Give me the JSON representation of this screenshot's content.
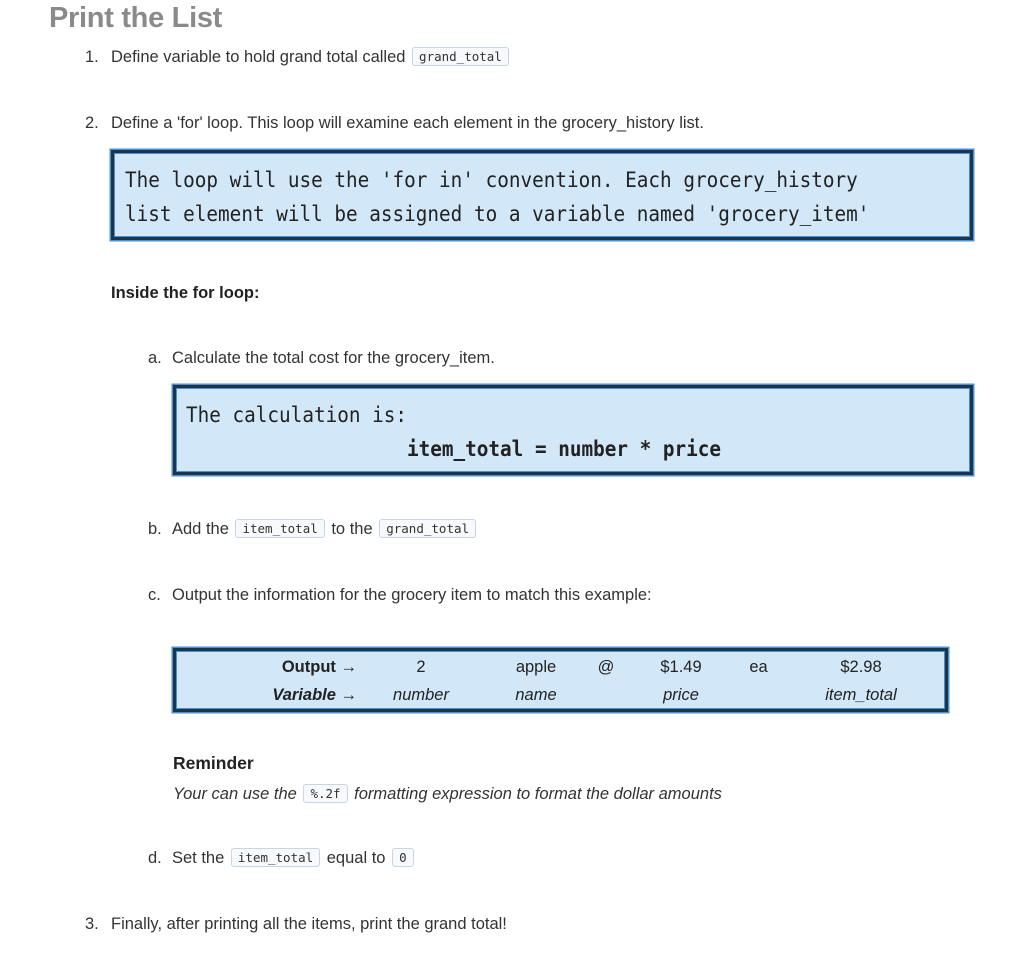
{
  "heading": "Print the List",
  "steps": {
    "s1": {
      "num": "1.",
      "text": "Define variable to hold grand total called",
      "code": "grand_total"
    },
    "s2": {
      "num": "2.",
      "text": "Define a 'for' loop. This loop will examine each element in the grocery_history list."
    },
    "loop_box": {
      "line1": "The loop will use the 'for in' convention. Each grocery_history",
      "line2": "list element will be assigned to a variable named 'grocery_item'"
    },
    "inside_label": "Inside the for loop:",
    "a": {
      "num": "a.",
      "text": "Calculate the total cost for the grocery_item."
    },
    "calc_box": {
      "line1": "The calculation is:",
      "formula": "item_total = number * price"
    },
    "b": {
      "num": "b.",
      "prefix": "Add the",
      "code1": "item_total",
      "middle": "to the",
      "code2": "grand_total"
    },
    "c": {
      "num": "c.",
      "text": "Output the information for the grocery item to match this example:"
    },
    "example_table": {
      "output_label": "Output →",
      "variable_label": "Variable →",
      "output_values": [
        "2",
        "apple",
        "@",
        "$1.49",
        "ea",
        "$2.98"
      ],
      "variable_values": [
        "number",
        "name",
        "",
        "price",
        "",
        "item_total"
      ]
    },
    "reminder": {
      "title": "Reminder",
      "prefix": "Your can use the",
      "code": "%.2f",
      "suffix": "formatting expression to format the dollar amounts"
    },
    "d": {
      "num": "d.",
      "prefix": "Set the",
      "code1": "item_total",
      "middle": "equal to",
      "code2": "0"
    },
    "s3": {
      "num": "3.",
      "text": "Finally, after printing all the items, print the grand total!"
    }
  }
}
